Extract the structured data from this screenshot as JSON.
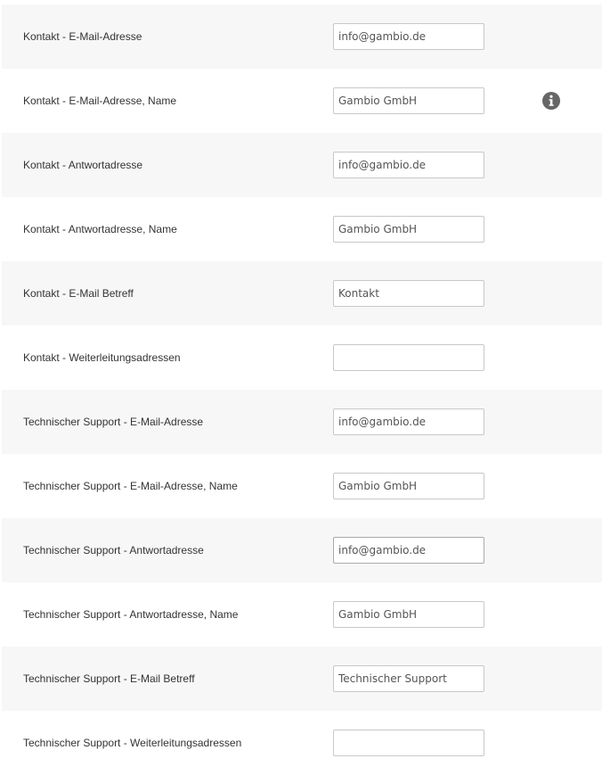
{
  "settings": {
    "rows": [
      {
        "label": "Kontakt - E-Mail-Adresse",
        "value": "info@gambio.de"
      },
      {
        "label": "Kontakt - E-Mail-Adresse, Name",
        "value": "Gambio GmbH",
        "info_icon": "info-circle-icon"
      },
      {
        "label": "Kontakt - Antwortadresse",
        "value": "info@gambio.de"
      },
      {
        "label": "Kontakt - Antwortadresse, Name",
        "value": "Gambio GmbH"
      },
      {
        "label": "Kontakt - E-Mail Betreff",
        "value": "Kontakt"
      },
      {
        "label": "Kontakt - Weiterleitungsadressen",
        "value": ""
      },
      {
        "label": "Technischer Support - E-Mail-Adresse",
        "value": "info@gambio.de"
      },
      {
        "label": "Technischer Support - E-Mail-Adresse, Name",
        "value": "Gambio GmbH"
      },
      {
        "label": "Technischer Support - Antwortadresse",
        "value": "info@gambio.de"
      },
      {
        "label": "Technischer Support - Antwortadresse, Name",
        "value": "Gambio GmbH"
      },
      {
        "label": "Technischer Support - E-Mail Betreff",
        "value": "Technischer Support"
      },
      {
        "label": "Technischer Support - Weiterleitungsadressen",
        "value": ""
      }
    ]
  },
  "colors": {
    "row_alt_background": "#f7f7f7",
    "label_text": "#333333",
    "input_border": "#c8c8c8",
    "info_icon": "#666666"
  }
}
